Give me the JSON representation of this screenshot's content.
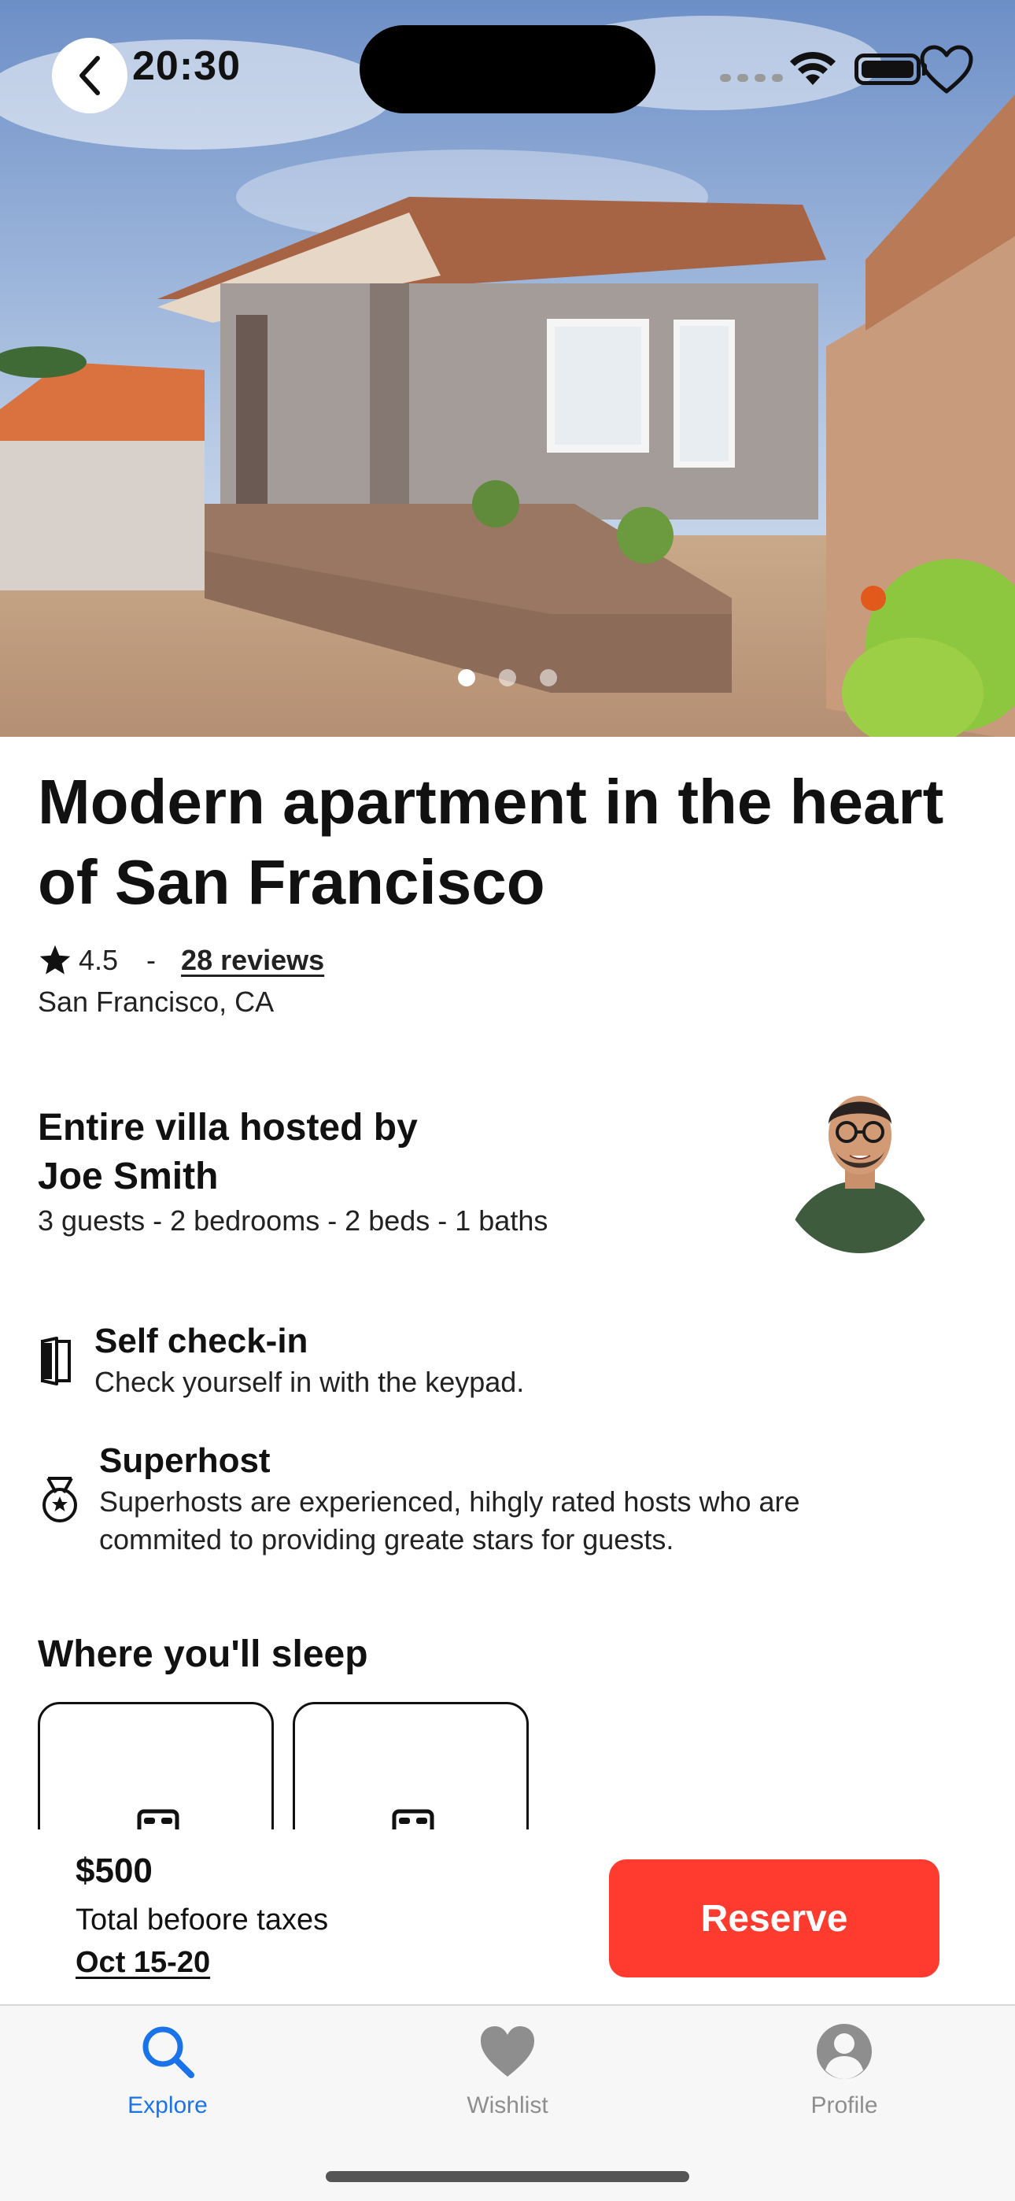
{
  "status_bar": {
    "time": "20:30"
  },
  "hero": {
    "image_alt": "house-photo",
    "page_count": 3,
    "active_page": 0
  },
  "listing": {
    "title": "Modern apartment in the heart of San Francisco",
    "rating": "4.5",
    "separator": "-",
    "reviews": "28 reviews",
    "location": "San Francisco, CA"
  },
  "host": {
    "title_line1": "Entire villa hosted by",
    "title_line2": "Joe Smith",
    "details": "3 guests - 2 bedrooms - 2 beds - 1 baths"
  },
  "features": [
    {
      "icon": "door-icon",
      "title": "Self check-in",
      "description": "Check yourself in with the keypad."
    },
    {
      "icon": "medal-icon",
      "title": "Superhost",
      "description": "Superhosts are experienced, hihgly rated hosts who are commited to providing greate stars for guests."
    }
  ],
  "sleep": {
    "title": "Where you'll sleep",
    "card_icon": "bed-icon"
  },
  "reserve": {
    "price": "$500",
    "price_note": "Total befoore taxes",
    "dates": "Oct 15-20",
    "button_label": "Reserve"
  },
  "tabs": [
    {
      "label": "Explore",
      "icon": "search-icon",
      "active": true
    },
    {
      "label": "Wishlist",
      "icon": "heart-icon",
      "active": false
    },
    {
      "label": "Profile",
      "icon": "person-icon",
      "active": false
    }
  ],
  "colors": {
    "accent": "#ff3b30",
    "tab_active": "#1a73e8",
    "tab_inactive": "#8e8e8e"
  }
}
